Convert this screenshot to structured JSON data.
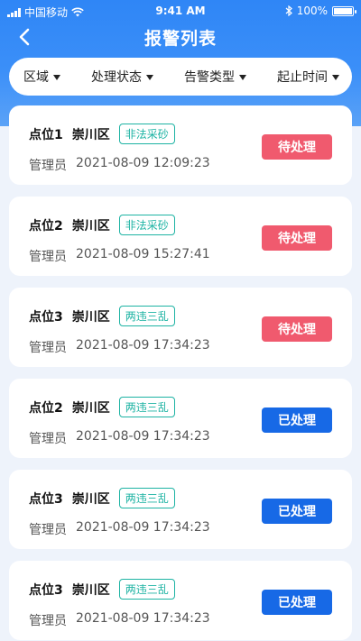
{
  "status_bar": {
    "carrier": "中国移动",
    "time": "9:41 AM",
    "battery": "100%"
  },
  "nav": {
    "title": "报警列表"
  },
  "filters": [
    {
      "label": "区域"
    },
    {
      "label": "处理状态"
    },
    {
      "label": "告警类型"
    },
    {
      "label": "起止时间"
    }
  ],
  "alarms": [
    {
      "point": "点位1",
      "district": "崇川区",
      "type": "非法采砂",
      "manager_label": "管理员",
      "datetime": "2021-08-09 12:09:23",
      "status": "待处理",
      "status_kind": "pending"
    },
    {
      "point": "点位2",
      "district": "崇川区",
      "type": "非法采砂",
      "manager_label": "管理员",
      "datetime": "2021-08-09 15:27:41",
      "status": "待处理",
      "status_kind": "pending"
    },
    {
      "point": "点位3",
      "district": "崇川区",
      "type": "两违三乱",
      "manager_label": "管理员",
      "datetime": "2021-08-09 17:34:23",
      "status": "待处理",
      "status_kind": "pending"
    },
    {
      "point": "点位2",
      "district": "崇川区",
      "type": "两违三乱",
      "manager_label": "管理员",
      "datetime": "2021-08-09 17:34:23",
      "status": "已处理",
      "status_kind": "done"
    },
    {
      "point": "点位3",
      "district": "崇川区",
      "type": "两违三乱",
      "manager_label": "管理员",
      "datetime": "2021-08-09 17:34:23",
      "status": "已处理",
      "status_kind": "done"
    },
    {
      "point": "点位3",
      "district": "崇川区",
      "type": "两违三乱",
      "manager_label": "管理员",
      "datetime": "2021-08-09 17:34:23",
      "status": "已处理",
      "status_kind": "done"
    }
  ],
  "colors": {
    "header_blue": "#2f86f6",
    "pending_red": "#f05a6e",
    "done_blue": "#1769e6",
    "tag_teal": "#1db3a3"
  }
}
